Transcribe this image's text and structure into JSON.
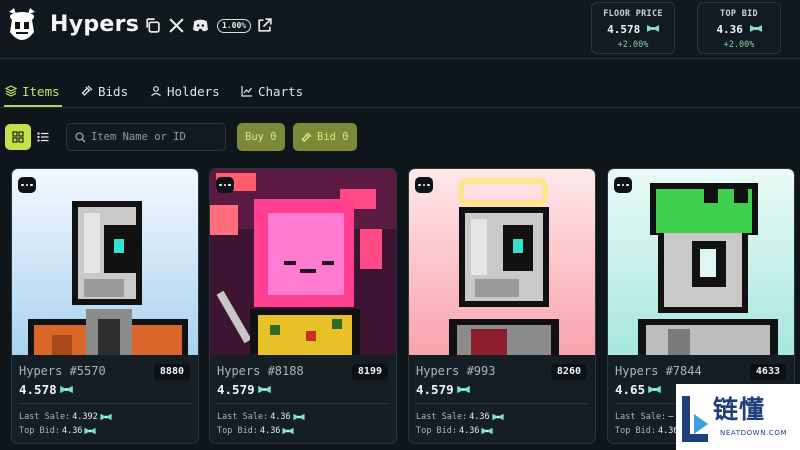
{
  "app": {
    "title": "Hypers",
    "change_badge": "1.00%"
  },
  "header_icons": [
    "copy-icon",
    "x-logo-icon",
    "discord-icon",
    "external-link-icon"
  ],
  "stats": [
    {
      "label": "FLOOR PRICE",
      "value": "4.578",
      "change": "+2.00%"
    },
    {
      "label": "TOP BID",
      "value": "4.36",
      "change": "+2.00%"
    }
  ],
  "tabs": [
    {
      "label": "Items",
      "icon": "layers-icon",
      "active": true
    },
    {
      "label": "Bids",
      "icon": "gavel-icon",
      "active": false
    },
    {
      "label": "Holders",
      "icon": "users-icon",
      "active": false
    },
    {
      "label": "Charts",
      "icon": "line-chart-icon",
      "active": false
    }
  ],
  "toolbar": {
    "search_placeholder": "Item Name or ID",
    "buy_label": "Buy 0",
    "bid_label": "Bid 0"
  },
  "cards": [
    {
      "name": "Hypers #5570",
      "rank": "8880",
      "price": "4.578",
      "last_sale_label": "Last Sale:",
      "last_sale": "4.392",
      "top_bid_label": "Top Bid:",
      "top_bid": "4.36"
    },
    {
      "name": "Hypers #8188",
      "rank": "8199",
      "price": "4.579",
      "last_sale_label": "Last Sale:",
      "last_sale": "4.36",
      "top_bid_label": "Top Bid:",
      "top_bid": "4.36"
    },
    {
      "name": "Hypers #993",
      "rank": "8260",
      "price": "4.579",
      "last_sale_label": "Last Sale:",
      "last_sale": "4.36",
      "top_bid_label": "Top Bid:",
      "top_bid": "4.36"
    },
    {
      "name": "Hypers #7844",
      "rank": "4633",
      "price": "4.65",
      "last_sale_label": "Last Sale:",
      "last_sale": "–",
      "top_bid_label": "Top Bid:",
      "top_bid": "4.36"
    }
  ],
  "watermark": {
    "cn": "链懂",
    "en": "NEATDOWN.COM"
  },
  "colors": {
    "accent": "#c6e04c",
    "positive": "#7fd1a6",
    "background": "#0f161b",
    "token": "#7de0d0"
  }
}
